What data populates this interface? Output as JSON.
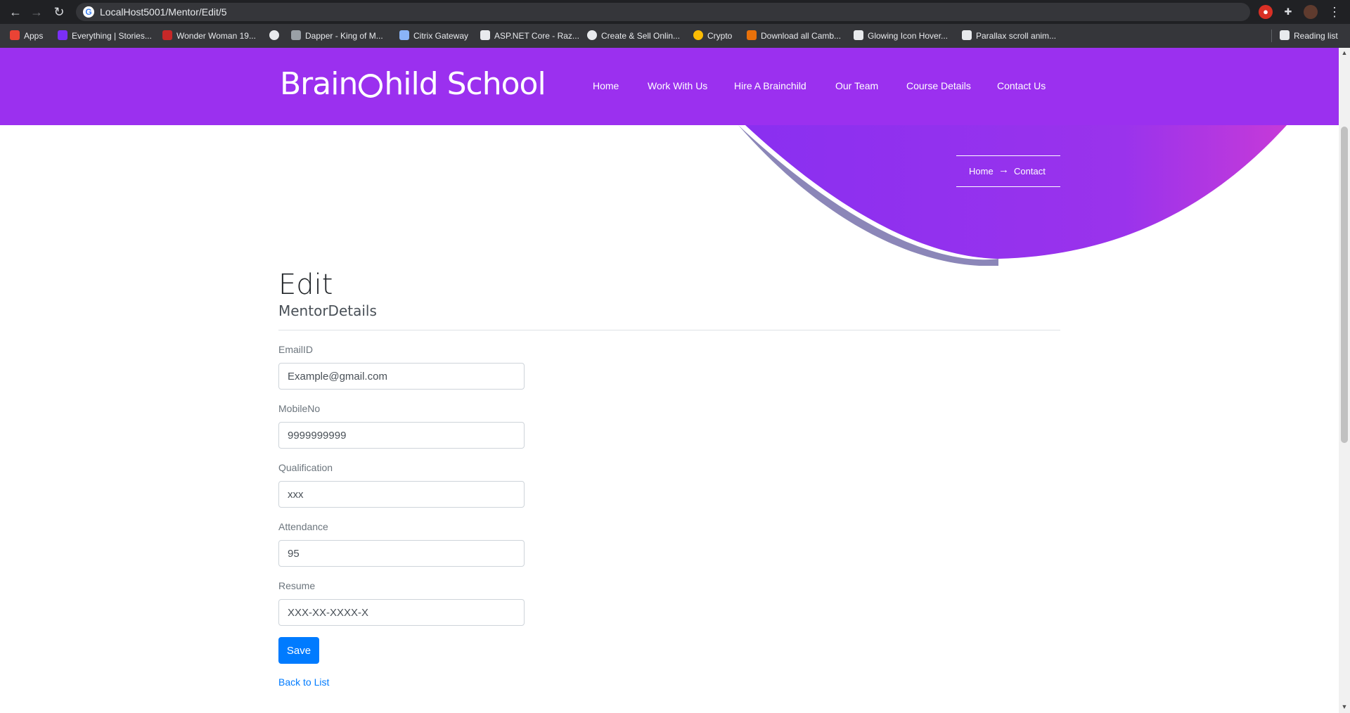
{
  "browser": {
    "url": "LocalHost5001/Mentor/Edit/5",
    "back_icon": "←",
    "forward_icon": "→",
    "reload_icon": "↻",
    "menu_icon": "⋮",
    "bookmarks": [
      {
        "label": "Apps",
        "color": "#ea4335"
      },
      {
        "label": "Everything | Stories...",
        "color": "#7b2ff7"
      },
      {
        "label": "Wonder Woman 19...",
        "color": "#c62828"
      },
      {
        "label": "",
        "color": "#e8eaed"
      },
      {
        "label": "Dapper - King of M...",
        "color": "#9aa0a6"
      },
      {
        "label": "Citrix Gateway",
        "color": "#8ab4f8"
      },
      {
        "label": "ASP.NET Core - Raz...",
        "color": "#e8eaed"
      },
      {
        "label": "Create & Sell Onlin...",
        "color": "#e8eaed"
      },
      {
        "label": "Crypto",
        "color": "#fbbc04"
      },
      {
        "label": "Download all Camb...",
        "color": "#e8710a"
      },
      {
        "label": "Glowing Icon Hover...",
        "color": "#e8eaed"
      },
      {
        "label": "Parallax scroll anim...",
        "color": "#e8eaed"
      }
    ],
    "reading_list": "Reading list"
  },
  "site": {
    "logo_part1": "Brain",
    "logo_part2": "hild School",
    "brand_color": "#9b30ef",
    "nav": [
      "Home",
      "Work With Us",
      "Hire A Brainchild",
      "Our Team",
      "Course Details",
      "Contact Us"
    ],
    "breadcrumb": {
      "home": "Home",
      "arrow": "→",
      "current": "Contact"
    }
  },
  "form": {
    "title": "Edit",
    "subtitle": "MentorDetails",
    "fields": [
      {
        "label": "EmailID",
        "value": "Example@gmail.com"
      },
      {
        "label": "MobileNo",
        "value": "9999999999"
      },
      {
        "label": "Qualification",
        "value": "xxx"
      },
      {
        "label": "Attendance",
        "value": "95"
      },
      {
        "label": "Resume",
        "value": "XXX-XX-XXXX-X"
      }
    ],
    "save_label": "Save",
    "back_label": "Back to List"
  }
}
